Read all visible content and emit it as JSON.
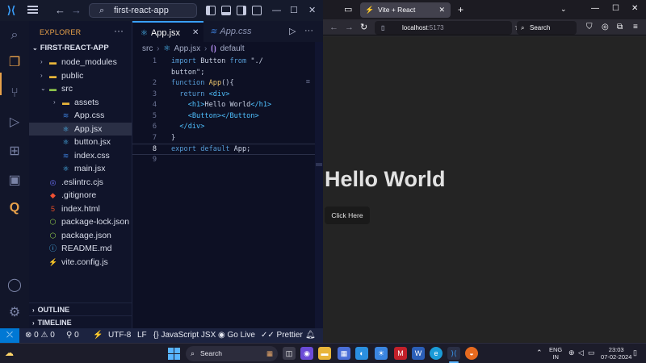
{
  "vscode": {
    "search_text": "first-react-app",
    "explorer_title": "EXPLORER",
    "project": "FIRST-REACT-APP",
    "tree": [
      {
        "label": "node_modules",
        "type": "folder-closed",
        "depth": 1
      },
      {
        "label": "public",
        "type": "folder-closed",
        "depth": 1
      },
      {
        "label": "src",
        "type": "folder-open",
        "depth": 1
      },
      {
        "label": "assets",
        "type": "folder-closed",
        "depth": 2
      },
      {
        "label": "App.css",
        "type": "css",
        "depth": 2
      },
      {
        "label": "App.jsx",
        "type": "react",
        "depth": 2,
        "selected": true
      },
      {
        "label": "button.jsx",
        "type": "react",
        "depth": 2
      },
      {
        "label": "index.css",
        "type": "css",
        "depth": 2
      },
      {
        "label": "main.jsx",
        "type": "react",
        "depth": 2
      },
      {
        "label": ".eslintrc.cjs",
        "type": "eslint",
        "depth": 1
      },
      {
        "label": ".gitignore",
        "type": "git",
        "depth": 1
      },
      {
        "label": "index.html",
        "type": "html",
        "depth": 1
      },
      {
        "label": "package-lock.json",
        "type": "json",
        "depth": 1
      },
      {
        "label": "package.json",
        "type": "json",
        "depth": 1
      },
      {
        "label": "README.md",
        "type": "info",
        "depth": 1
      },
      {
        "label": "vite.config.js",
        "type": "vite",
        "depth": 1
      }
    ],
    "outline_label": "OUTLINE",
    "timeline_label": "TIMELINE",
    "tabs": [
      {
        "label": "App.jsx",
        "active": true
      },
      {
        "label": "App.css",
        "active": false
      }
    ],
    "breadcrumb": [
      "src",
      "App.jsx",
      "default"
    ],
    "code_lines": [
      {
        "n": "1",
        "text": "import Button from \"./"
      },
      {
        "n": "",
        "text": "button\";"
      },
      {
        "n": "2",
        "text": "function App(){"
      },
      {
        "n": "3",
        "text": "  return <div>"
      },
      {
        "n": "4",
        "text": "    <h1>Hello World</h1>"
      },
      {
        "n": "5",
        "text": "    <Button></Button>"
      },
      {
        "n": "6",
        "text": "  </div>"
      },
      {
        "n": "7",
        "text": "}"
      },
      {
        "n": "8",
        "text": "export default App;"
      },
      {
        "n": "9",
        "text": ""
      }
    ],
    "status": {
      "errors": "0",
      "warnings": "0",
      "ports": "0",
      "encoding": "UTF-8",
      "eol": "LF",
      "language": "JavaScript JSX",
      "golive": "Go Live",
      "prettier": "Prettier"
    }
  },
  "firefox": {
    "tab_title": "Vite + React",
    "url_host": "localhost",
    "url_port": ":5173",
    "search_placeholder": "Search",
    "page_heading": "Hello World",
    "page_button": "Click Here"
  },
  "taskbar": {
    "search_placeholder": "Search",
    "lang_top": "ENG",
    "lang_bottom": "IN",
    "time": "23:03",
    "date": "07-02-2024"
  },
  "colors": {
    "accent_orange": "#e8a14a",
    "vscode_blue": "#0078d4",
    "react_blue": "#4fc1ff"
  }
}
